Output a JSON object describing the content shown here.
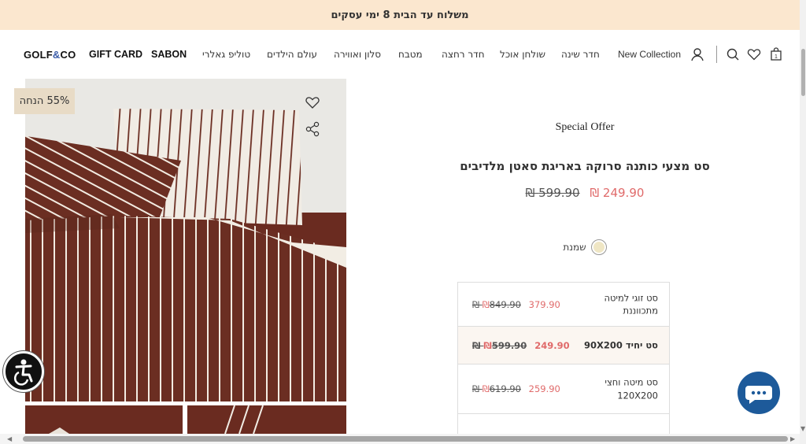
{
  "announcement": "משלוח עד הבית 8 ימי עסקים",
  "header": {
    "logo": {
      "part1": "GOLF",
      "amp": "&",
      "part2": "CO"
    },
    "nav": {
      "gift_card": "GIFT CARD",
      "sabon": "SABON",
      "toliph_gallery": "טוליפ גאלרי",
      "kids_world": "עולם הילדים",
      "living_room": "סלון ואווירה",
      "kitchen": "מטבח",
      "bathroom": "חדר רחצה",
      "dining": "שולחן אוכל",
      "bedroom": "חדר שינה",
      "new_collection": "New Collection"
    },
    "cart_count": "1"
  },
  "gallery": {
    "discount_badge": "55% הנחה"
  },
  "product": {
    "label": "Special Offer",
    "title": "סט מצעי כותנה סרוקה באריגת סאטן מלדיבים",
    "price_new": "249.90 ₪",
    "price_old": "599.90 ₪",
    "color_name": "שמנת",
    "sizes": [
      {
        "name": "סט זוגי למיטה מתכווננת",
        "price_new": "379.90 ₪",
        "price_old": "849.90 ₪"
      },
      {
        "name": "סט יחיד 90X200",
        "price_new": "249.90 ₪",
        "price_old": "599.90 ₪"
      },
      {
        "name": "סט מיטה וחצי 120X200",
        "price_new": "259.90 ₪",
        "price_old": "619.90 ₪"
      }
    ]
  },
  "colors": {
    "announce_bg": "#fbe7cf",
    "sale_price": "#e06a6a",
    "chat_button": "#1d5a9a",
    "stripe_brown": "#6b2e22"
  }
}
